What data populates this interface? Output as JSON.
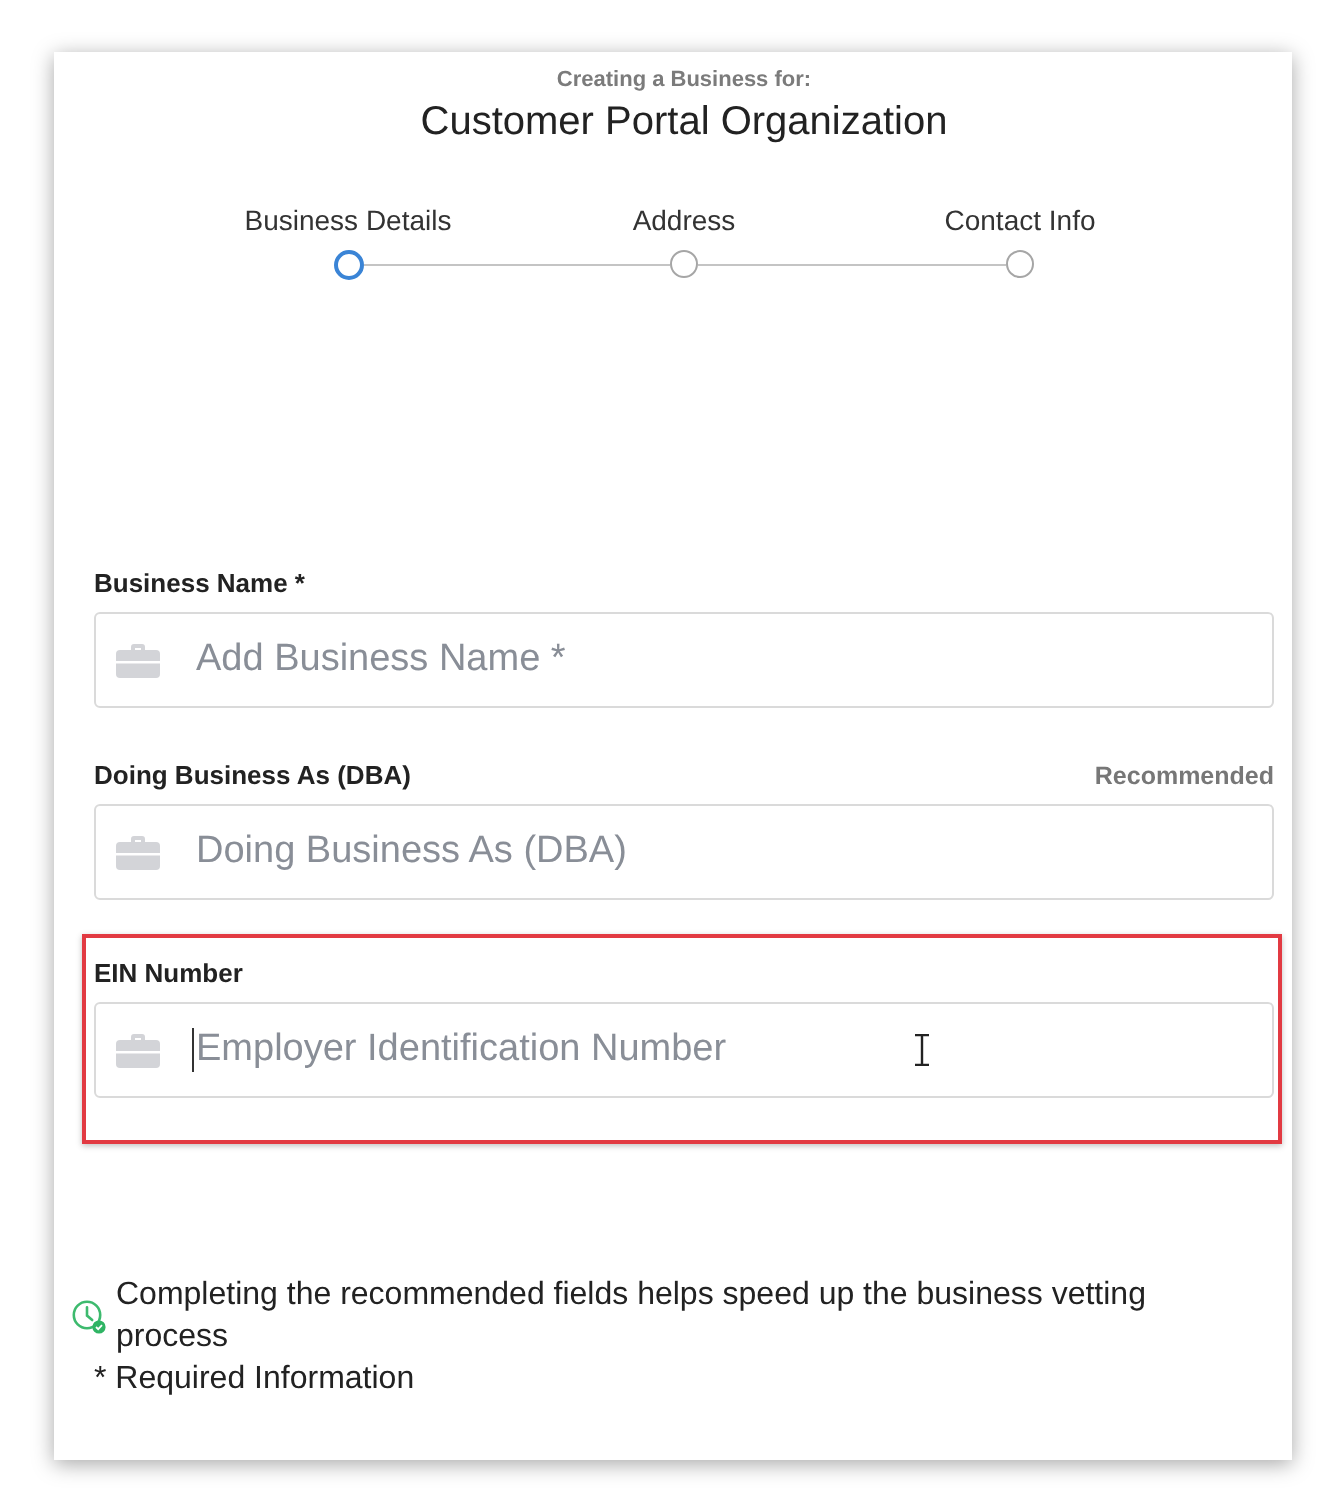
{
  "header": {
    "subtitle": "Creating a Business for:",
    "title": "Customer Portal Organization"
  },
  "steps": [
    {
      "label": "Business Details",
      "selected": true
    },
    {
      "label": "Address",
      "selected": false
    },
    {
      "label": "Contact Info",
      "selected": false
    }
  ],
  "fields": [
    {
      "label": "Business Name *",
      "placeholder": "Add Business Name *",
      "highlighted": false,
      "focused": false,
      "hovered": false
    },
    {
      "label": "Doing Business As (DBA)",
      "hint": "Recommended",
      "placeholder": "Doing Business As (DBA)",
      "highlighted": false,
      "focused": false,
      "hovered": false
    },
    {
      "label": "EIN Number",
      "placeholder": "Employer Identification Number",
      "highlighted": true,
      "focused": true,
      "hovered": true
    }
  ],
  "notes": {
    "tip": "Completing the recommended fields helps speed up the business vetting process",
    "required": "* Required Information"
  }
}
